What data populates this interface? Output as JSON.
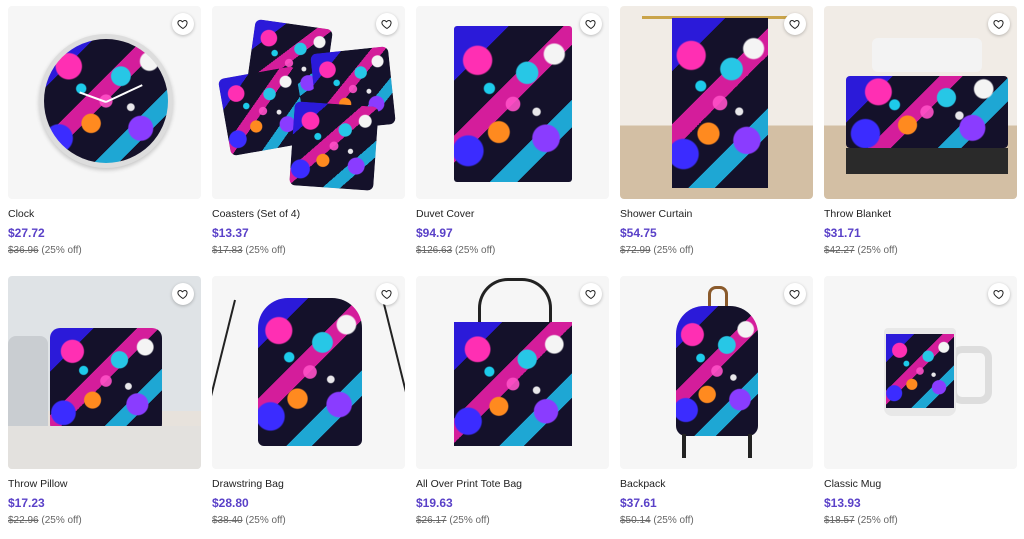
{
  "products": [
    {
      "name": "Clock",
      "price": "$27.72",
      "old_price": "$36.96",
      "discount": "(25% off)"
    },
    {
      "name": "Coasters (Set of 4)",
      "price": "$13.37",
      "old_price": "$17.83",
      "discount": "(25% off)"
    },
    {
      "name": "Duvet Cover",
      "price": "$94.97",
      "old_price": "$126.63",
      "discount": "(25% off)"
    },
    {
      "name": "Shower Curtain",
      "price": "$54.75",
      "old_price": "$72.99",
      "discount": "(25% off)"
    },
    {
      "name": "Throw Blanket",
      "price": "$31.71",
      "old_price": "$42.27",
      "discount": "(25% off)"
    },
    {
      "name": "Throw Pillow",
      "price": "$17.23",
      "old_price": "$22.96",
      "discount": "(25% off)"
    },
    {
      "name": "Drawstring Bag",
      "price": "$28.80",
      "old_price": "$38.40",
      "discount": "(25% off)"
    },
    {
      "name": "All Over Print Tote Bag",
      "price": "$19.63",
      "old_price": "$26.17",
      "discount": "(25% off)"
    },
    {
      "name": "Backpack",
      "price": "$37.61",
      "old_price": "$50.14",
      "discount": "(25% off)"
    },
    {
      "name": "Classic Mug",
      "price": "$13.93",
      "old_price": "$18.57",
      "discount": "(25% off)"
    }
  ],
  "icons": {
    "favorite": "heart-outline-icon"
  },
  "colors": {
    "price": "#5a41c8",
    "pattern_pink": "#ff2fb3",
    "pattern_blue": "#2b1ad9",
    "pattern_cyan": "#27c7e6",
    "pattern_orange": "#ff8a1f"
  }
}
